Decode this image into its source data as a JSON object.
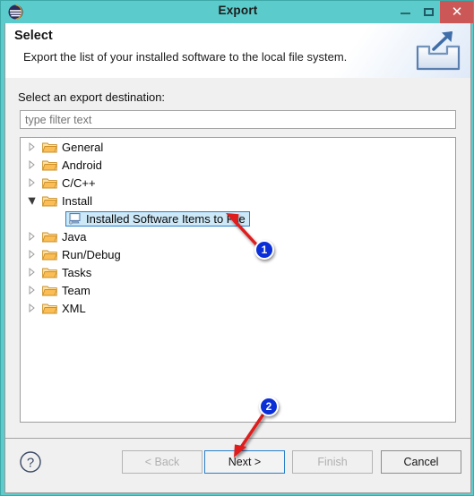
{
  "window": {
    "title": "Export",
    "icon": "eclipse-icon",
    "accent_color": "#5BCBCB",
    "close_color": "#cc5757",
    "controls": {
      "minimize": "–",
      "maximize": "□",
      "close": "✕"
    }
  },
  "header": {
    "title": "Select",
    "description": "Export the list of your installed software to the local file system.",
    "icon": "export-arrow-icon"
  },
  "body": {
    "destination_label": "Select an export destination:",
    "filter": {
      "value": "",
      "placeholder": "type filter text"
    },
    "tree": [
      {
        "label": "General",
        "expanded": false,
        "icon": "folder-icon"
      },
      {
        "label": "Android",
        "expanded": false,
        "icon": "folder-icon"
      },
      {
        "label": "C/C++",
        "expanded": false,
        "icon": "folder-icon"
      },
      {
        "label": "Install",
        "expanded": true,
        "icon": "folder-icon"
      },
      {
        "label": "Java",
        "expanded": false,
        "icon": "folder-icon"
      },
      {
        "label": "Run/Debug",
        "expanded": false,
        "icon": "folder-icon"
      },
      {
        "label": "Tasks",
        "expanded": false,
        "icon": "folder-icon"
      },
      {
        "label": "Team",
        "expanded": false,
        "icon": "folder-icon"
      },
      {
        "label": "XML",
        "expanded": false,
        "icon": "folder-icon"
      }
    ],
    "selected_child": {
      "label": "Installed Software Items to File",
      "icon": "installed-software-icon",
      "selection_border": "#2a7fc9",
      "selection_fill": "#cde8f7"
    }
  },
  "footer": {
    "help_icon": "question-mark-icon",
    "buttons": [
      {
        "label": "< Back",
        "state": "disabled"
      },
      {
        "label": "Next >",
        "state": "focused"
      },
      {
        "label": "Finish",
        "state": "disabled"
      },
      {
        "label": "Cancel",
        "state": "enabled"
      }
    ]
  },
  "annotations": {
    "color": "#e01b1b",
    "badges": [
      {
        "label": "1",
        "points_to": "Installed Software Items to File"
      },
      {
        "label": "2",
        "points_to": "Next >"
      }
    ]
  }
}
